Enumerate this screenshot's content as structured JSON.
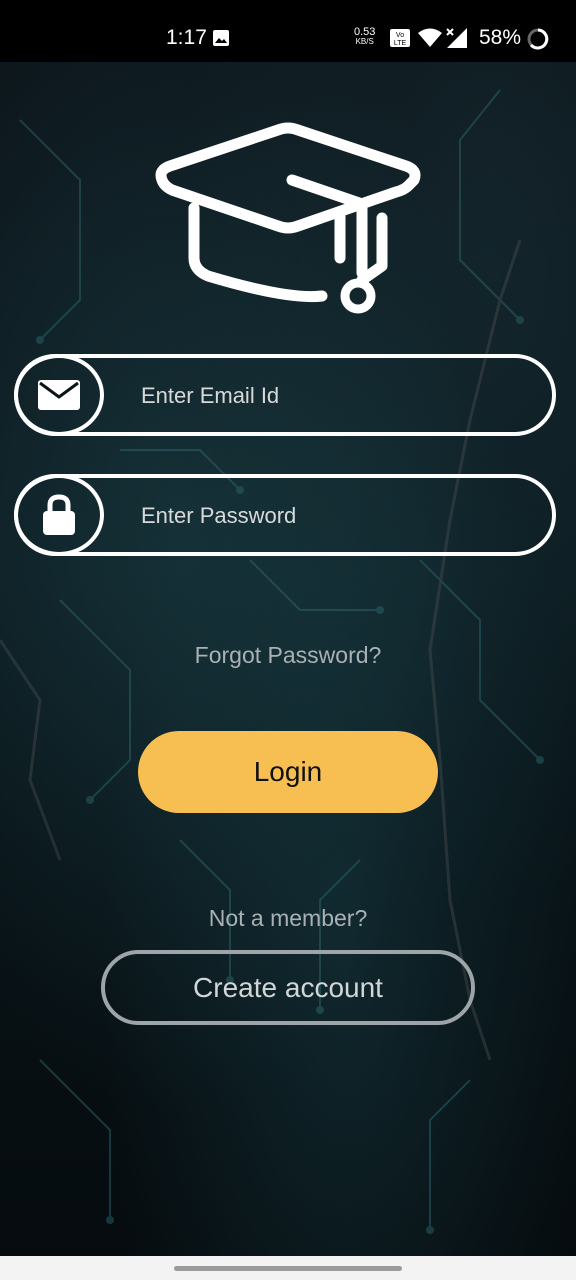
{
  "status_bar": {
    "time": "1:17",
    "net_speed_value": "0.53",
    "net_speed_unit": "KB/S",
    "volte_label": "Vo LTE",
    "battery": "58%",
    "icons": [
      "image-icon",
      "volte-icon",
      "wifi-icon",
      "signal-icon",
      "battery-icon"
    ]
  },
  "logo": {
    "icon": "graduation-cap-icon"
  },
  "email_field": {
    "placeholder": "Enter Email Id",
    "value": "",
    "icon": "envelope-icon"
  },
  "password_field": {
    "placeholder": "Enter Password",
    "value": "",
    "icon": "lock-icon"
  },
  "forgot_password_label": "Forgot Password?",
  "login_label": "Login",
  "not_member_label": "Not a member?",
  "create_account_label": "Create account",
  "colors": {
    "accent": "#f7bf52",
    "text_muted": "#a9b1b4",
    "outline": "#ffffff"
  }
}
